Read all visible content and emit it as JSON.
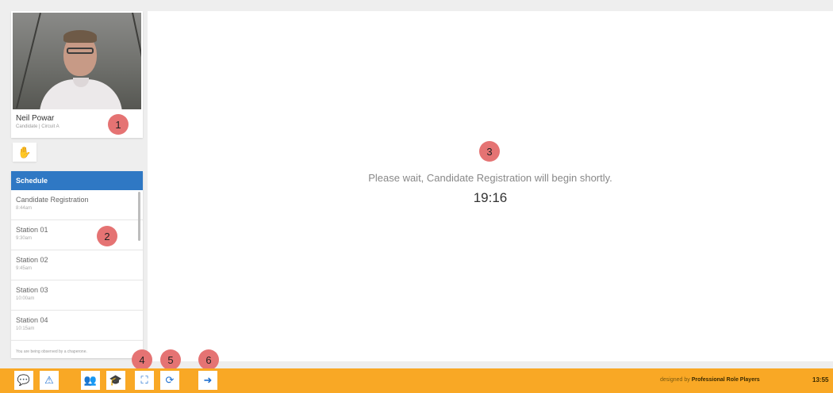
{
  "profile": {
    "name": "Neil Powar",
    "role": "Candidate | Circuit A"
  },
  "schedule": {
    "header": "Schedule",
    "items": [
      {
        "title": "Candidate Registration",
        "time": "8:44am"
      },
      {
        "title": "Station 01",
        "time": "9:30am"
      },
      {
        "title": "Station 02",
        "time": "9:45am"
      },
      {
        "title": "Station 03",
        "time": "10:00am"
      },
      {
        "title": "Station 04",
        "time": "10:15am"
      }
    ],
    "footer": "You are being observed by a chaperone."
  },
  "main": {
    "message": "Please wait, Candidate Registration will begin shortly.",
    "timer": "19:16"
  },
  "markers": [
    "1",
    "2",
    "3",
    "4",
    "5",
    "6"
  ],
  "footer": {
    "designed_prefix": "designed by",
    "designed_brand": "Professional Role Players",
    "clock": "13:55"
  },
  "icons": {
    "raise_hand": "hand-icon",
    "chat": "chat-icon",
    "alert": "warning-icon",
    "users": "user-settings-icon",
    "graduate": "graduation-cap-icon",
    "fullscreen": "fullscreen-icon",
    "refresh": "refresh-icon",
    "logout": "logout-icon"
  },
  "colors": {
    "accent": "#2f78c4",
    "bar": "#f9a825",
    "marker": "#e57373"
  }
}
